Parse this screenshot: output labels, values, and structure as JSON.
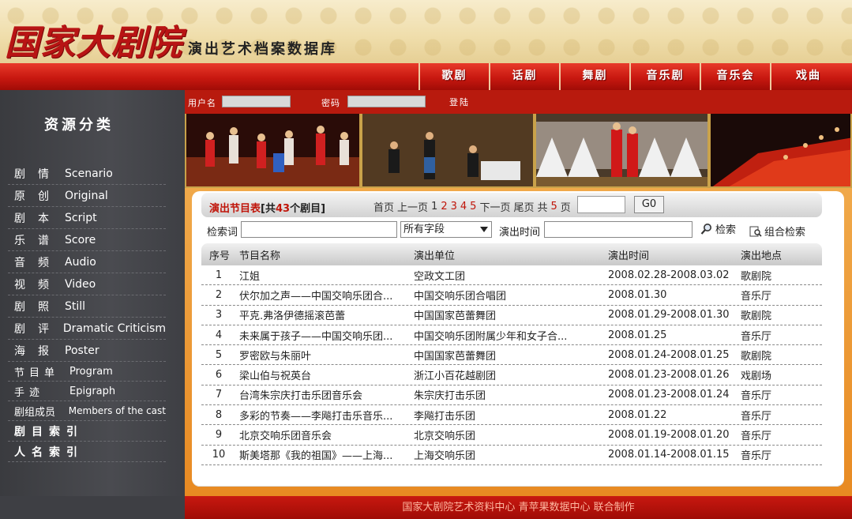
{
  "header": {
    "logo": "国家大剧院",
    "subtitle": "演出艺术档案数据库"
  },
  "nav": {
    "items": [
      "歌剧",
      "话剧",
      "舞剧",
      "音乐剧",
      "音乐会",
      "戏曲"
    ]
  },
  "sidebar": {
    "title": "资源分类",
    "categories": [
      {
        "zh": "剧情",
        "en": "Scenario"
      },
      {
        "zh": "原创",
        "en": "Original"
      },
      {
        "zh": "剧本",
        "en": "Script"
      },
      {
        "zh": "乐谱",
        "en": "Score"
      },
      {
        "zh": "音频",
        "en": "Audio"
      },
      {
        "zh": "视频",
        "en": "Video"
      },
      {
        "zh": "剧照",
        "en": "Still"
      },
      {
        "zh": "剧评",
        "en": "Dramatic Criticism"
      },
      {
        "zh": "海报",
        "en": "Poster"
      },
      {
        "zh": "节目单",
        "en": "Program"
      },
      {
        "zh": "手迹",
        "en": "Epigraph"
      },
      {
        "zh": "剧组成员",
        "en": "Members of the cast"
      }
    ],
    "index_links": [
      "剧目索引",
      "人名索引"
    ]
  },
  "login": {
    "username_label": "用户名",
    "password_label": "密码",
    "login_label": "登陆"
  },
  "list": {
    "title": "演出节目表",
    "count_prefix": "[共",
    "count": "43",
    "count_suffix": "个剧目]"
  },
  "pager": {
    "first": "首页",
    "prev": "上一页",
    "pages": [
      "1",
      "2",
      "3",
      "4",
      "5"
    ],
    "current": "1",
    "next": "下一页",
    "last": "尾页",
    "total_prefix": "共",
    "total_pages": "5",
    "total_suffix": "页",
    "go_label": "G0"
  },
  "search": {
    "keyword_label": "检索词",
    "keyword_value": "",
    "field_selected": "所有字段",
    "time_label": "演出时间",
    "time_value": "",
    "search_button": "检索",
    "advanced_button": "组合检索"
  },
  "table": {
    "headers": [
      "序号",
      "节目名称",
      "演出单位",
      "演出时间",
      "演出地点"
    ],
    "rows": [
      {
        "no": "1",
        "name": "江姐",
        "unit": "空政文工团",
        "time": "2008.02.28-2008.03.02",
        "place": "歌剧院"
      },
      {
        "no": "2",
        "name": "伏尔加之声——中国交响乐团合...",
        "unit": "中国交响乐团合唱团",
        "time": "2008.01.30",
        "place": "音乐厅"
      },
      {
        "no": "3",
        "name": "平克.弗洛伊德摇滚芭蕾",
        "unit": "中国国家芭蕾舞团",
        "time": "2008.01.29-2008.01.30",
        "place": "歌剧院"
      },
      {
        "no": "4",
        "name": "未来属于孩子——中国交响乐团...",
        "unit": "中国交响乐团附属少年和女子合...",
        "time": "2008.01.25",
        "place": "音乐厅"
      },
      {
        "no": "5",
        "name": "罗密欧与朱丽叶",
        "unit": "中国国家芭蕾舞团",
        "time": "2008.01.24-2008.01.25",
        "place": "歌剧院"
      },
      {
        "no": "6",
        "name": "梁山伯与祝英台",
        "unit": "浙江小百花越剧团",
        "time": "2008.01.23-2008.01.26",
        "place": "戏剧场"
      },
      {
        "no": "7",
        "name": "台湾朱宗庆打击乐团音乐会",
        "unit": "朱宗庆打击乐团",
        "time": "2008.01.23-2008.01.24",
        "place": "音乐厅"
      },
      {
        "no": "8",
        "name": "多彩的节奏——李飚打击乐音乐...",
        "unit": "李飚打击乐团",
        "time": "2008.01.22",
        "place": "音乐厅"
      },
      {
        "no": "9",
        "name": "北京交响乐团音乐会",
        "unit": "北京交响乐团",
        "time": "2008.01.19-2008.01.20",
        "place": "音乐厅"
      },
      {
        "no": "10",
        "name": "斯美塔那《我的祖国》——上海...",
        "unit": "上海交响乐团",
        "time": "2008.01.14-2008.01.15",
        "place": "音乐厅"
      }
    ]
  },
  "footer": {
    "text": "国家大剧院艺术资料中心  青苹果数据中心  联合制作"
  },
  "colors": {
    "brand_red": "#c0150a",
    "nav_red": "#c81810",
    "sidebar_bg": "#434449",
    "content_orange": "#e88a22"
  }
}
